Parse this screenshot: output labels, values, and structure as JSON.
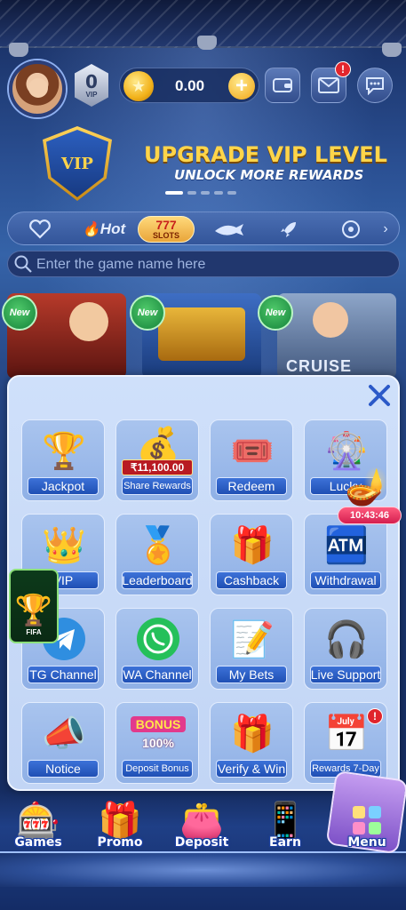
{
  "header": {
    "balance": "0.00",
    "vip_level": "0",
    "vip_label": "VIP",
    "notification_badge": "!"
  },
  "banner": {
    "title": "UPGRADE VIP LEVEL",
    "subtitle": "UNLOCK MORE REWARDS",
    "badge_text": "VIP"
  },
  "categories": {
    "hot_label": "Hot",
    "slots_label": "SLOTS",
    "active": "slots"
  },
  "search": {
    "placeholder": "Enter the game name here"
  },
  "games": {
    "new_label": "New",
    "cruise_text": "CRUISE"
  },
  "menu": {
    "tiles": [
      {
        "label": "Jackpot",
        "icon": "trophy-icon"
      },
      {
        "label": "Share Rewards",
        "icon": "treasure-chest-icon",
        "amount": "₹11,100.00"
      },
      {
        "label": "Redeem",
        "icon": "gift-ticket-icon"
      },
      {
        "label": "Lucky",
        "icon": "lucky-wheel-icon"
      },
      {
        "label": "VIP",
        "icon": "crown-icon"
      },
      {
        "label": "Leaderboard",
        "icon": "podium-icon"
      },
      {
        "label": "Cashback",
        "icon": "cashback-icon"
      },
      {
        "label": "Withdrawal",
        "icon": "atm-icon"
      },
      {
        "label": "TG Channel",
        "icon": "telegram-icon"
      },
      {
        "label": "WA Channel",
        "icon": "whatsapp-icon"
      },
      {
        "label": "My Bets",
        "icon": "notepad-icon"
      },
      {
        "label": "Live Support",
        "icon": "support-agent-icon"
      },
      {
        "label": "Notice",
        "icon": "megaphone-icon"
      },
      {
        "label": "Deposit Bonus",
        "icon": "bonus-icon",
        "bonus_text": "BONUS",
        "percent": "100%"
      },
      {
        "label": "Verify & Win",
        "icon": "gift-box-icon"
      },
      {
        "label": "Rewards 7-Day",
        "icon": "calendar-gift-icon"
      }
    ],
    "timer": "10:43:46",
    "fifa_label": "FIFA",
    "badge": "!"
  },
  "bottom_nav": [
    {
      "label": "Games",
      "icon": "slot-machine-icon"
    },
    {
      "label": "Promo",
      "icon": "gift-icon"
    },
    {
      "label": "Deposit",
      "icon": "wallet-icon"
    },
    {
      "label": "Earn",
      "icon": "phone-coins-icon"
    },
    {
      "label": "Menu",
      "icon": "menu-grid-icon"
    }
  ],
  "colors": {
    "accent_gold": "#ffd54a",
    "panel_bg": "#c2d5f5",
    "label_blue": "#2a5dc4",
    "alert_red": "#e0242c"
  }
}
